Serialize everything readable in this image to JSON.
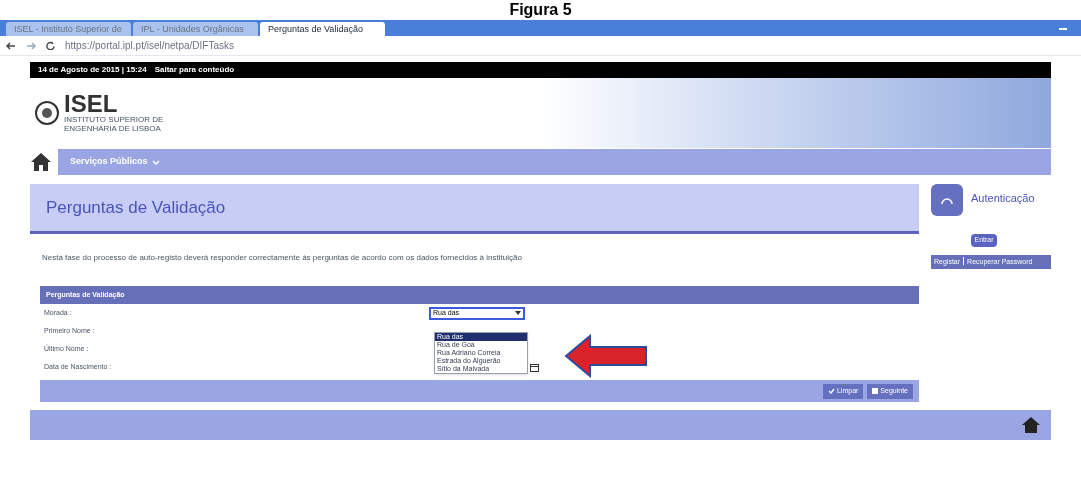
{
  "caption": "Figura 5",
  "tabs": [
    {
      "label": "ISEL - Instituto Superior de",
      "selected": false
    },
    {
      "label": "IPL - Unidades Orgânicas",
      "selected": false
    },
    {
      "label": "Perguntas de Validação",
      "selected": true
    }
  ],
  "address": "https://portal.ipl.pt/isel/netpa/DIFTasks",
  "topbar": {
    "date": "14 de Agosto de 2015 | 15:24",
    "skip_link": "Saltar para conteúdo"
  },
  "logo": {
    "name": "ISEL",
    "subtitle": "INSTITUTO SUPERIOR DE ENGENHARIA DE LISBOA"
  },
  "menu": {
    "item": "Serviços Públicos"
  },
  "page_title": "Perguntas de Validação",
  "intro": "Nesta fase do processo de auto-registo deverá responder correctamente às perguntas de acordo com os dados fornecidos à instituição",
  "form": {
    "title": "Perguntas de Validação",
    "fields": [
      {
        "label": "Morada :",
        "kind": "select",
        "value": "Rua das",
        "expanded": true,
        "options": [
          {
            "label": "Rua das",
            "selected": true
          },
          {
            "label": "Rua de Goa",
            "selected": false
          },
          {
            "label": "Rua Adriano Correia",
            "selected": false
          },
          {
            "label": "Estrada do Alguerão",
            "selected": false
          },
          {
            "label": "Sítio da Malvada",
            "selected": false
          }
        ]
      },
      {
        "label": "Primeiro Nome :",
        "kind": "text"
      },
      {
        "label": "Último Nome :",
        "kind": "text"
      },
      {
        "label": "Data de Nascimento :",
        "kind": "date"
      }
    ],
    "buttons": [
      "Limpar",
      "Seguinte"
    ]
  },
  "sidebar": {
    "title": "Autenticação",
    "login_button": "Entrar",
    "links": [
      "Registar",
      "Recuperar Password"
    ]
  }
}
